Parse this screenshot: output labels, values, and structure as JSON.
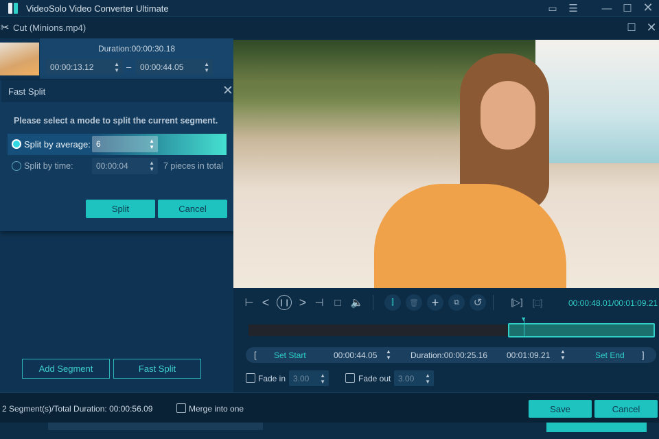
{
  "app": {
    "title": "VideoSolo Video Converter Ultimate"
  },
  "cut": {
    "title": "Cut (Minions.mp4)"
  },
  "segment": {
    "duration": "Duration:00:00:30.18",
    "start": "00:00:13.12",
    "end": "00:00:44.05",
    "dash": "–"
  },
  "fast_split": {
    "title": "Fast Split",
    "prompt": "Please select a mode to split the current segment.",
    "by_average_label": "Split by average:",
    "by_average_value": "6",
    "by_average_selected": true,
    "by_time_label": "Split by time:",
    "by_time_value": "00:00:04",
    "pieces": "7 pieces in total",
    "split_button": "Split",
    "cancel_button": "Cancel"
  },
  "left_buttons": {
    "add_segment": "Add Segment",
    "fast_split": "Fast Split"
  },
  "player": {
    "time": "00:00:48.01/00:01:09.21",
    "selection_start_fraction": 0.64,
    "playhead_fraction": 0.68
  },
  "range": {
    "set_start": "Set Start",
    "start": "00:00:44.05",
    "duration": "Duration:00:00:25.16",
    "end": "00:01:09.21",
    "set_end": "Set End",
    "open_bracket": "[",
    "close_bracket": "]"
  },
  "fade": {
    "in_label": "Fade in",
    "in_value": "3.00",
    "out_label": "Fade out",
    "out_value": "3.00"
  },
  "bottom": {
    "summary": "2 Segment(s)/Total Duration: 00:00:56.09",
    "merge_label": "Merge into one",
    "save": "Save",
    "cancel": "Cancel"
  },
  "colors": {
    "accent": "#1ec3c0",
    "background": "#0c2a43"
  }
}
